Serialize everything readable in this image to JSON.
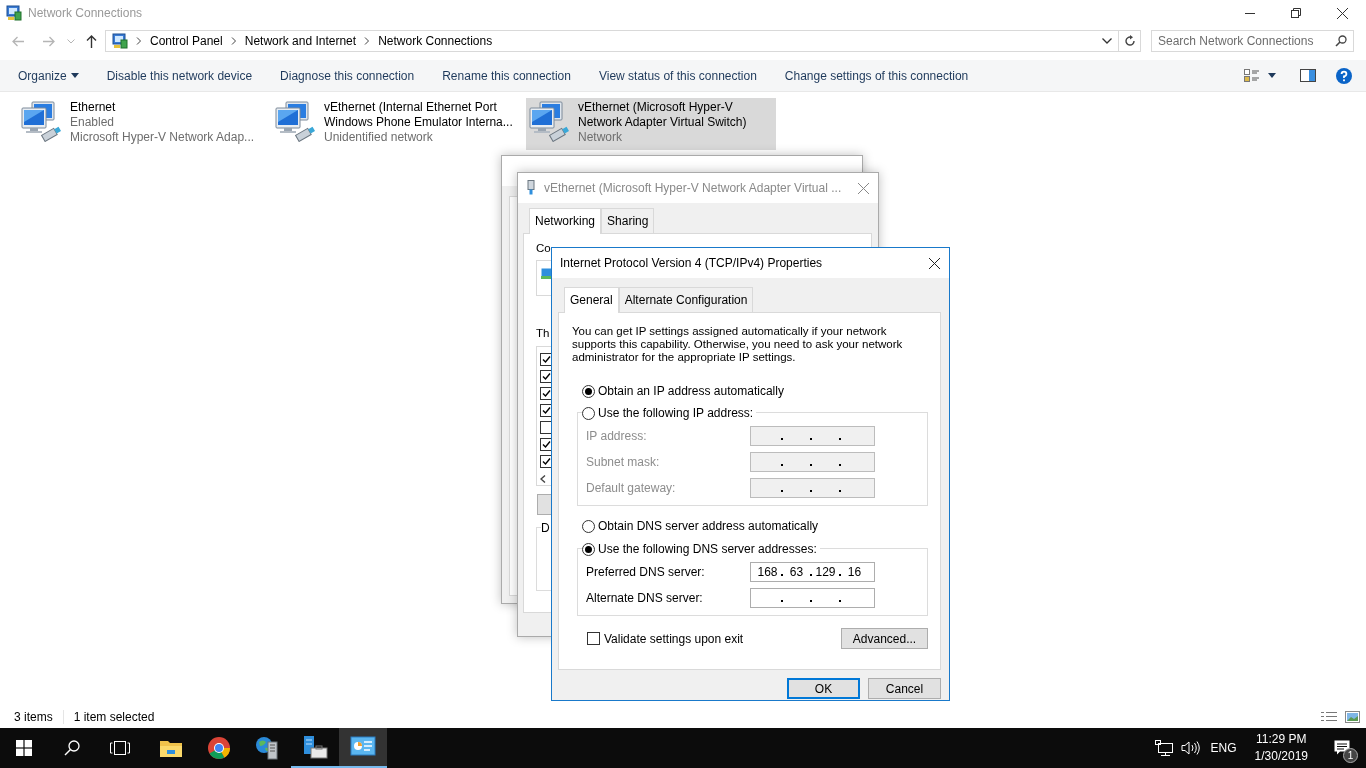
{
  "explorer": {
    "title": "Network Connections",
    "breadcrumbs": [
      "Control Panel",
      "Network and Internet",
      "Network Connections"
    ],
    "search": {
      "placeholder": "Search Network Connections"
    },
    "toolbar": [
      {
        "label": "Organize",
        "kind": "menu"
      },
      {
        "label": "Disable this network device",
        "kind": "command"
      },
      {
        "label": "Diagnose this connection",
        "kind": "command"
      },
      {
        "label": "Rename this connection",
        "kind": "command"
      },
      {
        "label": "View status of this connection",
        "kind": "command"
      },
      {
        "label": "Change settings of this connection",
        "kind": "command"
      }
    ],
    "connections": [
      {
        "name_lines": [
          "Ethernet"
        ],
        "status": "Enabled",
        "device": "Microsoft Hyper-V Network Adap...",
        "selected": false
      },
      {
        "name_lines": [
          "vEthernet (Internal Ethernet Port",
          "Windows Phone Emulator Interna..."
        ],
        "status": "Unidentified network",
        "selected": false
      },
      {
        "name_lines": [
          "vEthernet (Microsoft Hyper-V",
          "Network Adapter Virtual Switch)"
        ],
        "status": "Network",
        "selected": true
      }
    ],
    "status_bar": {
      "count": "3 items",
      "selection": "1 item selected"
    }
  },
  "adapter_dialog": {
    "title": "vEthernet (Microsoft Hyper-V Network Adapter Virtual ...",
    "tabs": [
      {
        "label": "Networking",
        "selected": true
      },
      {
        "label": "Sharing",
        "selected": false
      }
    ],
    "section_labels": [
      "Co",
      "Th"
    ],
    "group_label": "D",
    "components": [
      {
        "checked": true
      },
      {
        "checked": true
      },
      {
        "checked": true
      },
      {
        "checked": true
      },
      {
        "checked": false
      },
      {
        "checked": true
      },
      {
        "checked": true
      }
    ]
  },
  "ipv4_dialog": {
    "title": "Internet Protocol Version 4 (TCP/IPv4) Properties",
    "tabs": [
      {
        "label": "General",
        "selected": true
      },
      {
        "label": "Alternate Configuration",
        "selected": false
      }
    ],
    "description": "You can get IP settings assigned automatically if your network supports this capability. Otherwise, you need to ask your network administrator for the appropriate IP settings.",
    "ip_options": [
      {
        "label": "Obtain an IP address automatically",
        "selected": true
      },
      {
        "label": "Use the following IP address:",
        "selected": false
      }
    ],
    "ip_fields": [
      {
        "label": "IP address:",
        "disabled": true
      },
      {
        "label": "Subnet mask:",
        "disabled": true
      },
      {
        "label": "Default gateway:",
        "disabled": true
      }
    ],
    "dns_options": [
      {
        "label": "Obtain DNS server address automatically",
        "selected": false
      },
      {
        "label": "Use the following DNS server addresses:",
        "selected": true
      }
    ],
    "dns_fields": [
      {
        "label": "Preferred DNS server:",
        "disabled": false,
        "octets": [
          "168",
          "63",
          "129",
          "16"
        ]
      },
      {
        "label": "Alternate DNS server:",
        "disabled": false
      }
    ],
    "validate": {
      "label": "Validate settings upon exit",
      "checked": false
    },
    "advanced_button": "Advanced...",
    "buttons": [
      {
        "label": "OK",
        "default": true
      },
      {
        "label": "Cancel",
        "default": false
      }
    ]
  },
  "taskbar": {
    "apps": [
      {
        "kind": "file-explorer",
        "running": false,
        "selected": false
      },
      {
        "kind": "chrome",
        "running": false,
        "selected": false
      },
      {
        "kind": "network-app",
        "running": false,
        "selected": false
      },
      {
        "kind": "server-manager",
        "running": true,
        "selected": false
      },
      {
        "kind": "control-panel",
        "running": true,
        "selected": true
      }
    ],
    "language": "ENG",
    "time": "11:29 PM",
    "date": "1/30/2019",
    "notification_count": "1"
  }
}
